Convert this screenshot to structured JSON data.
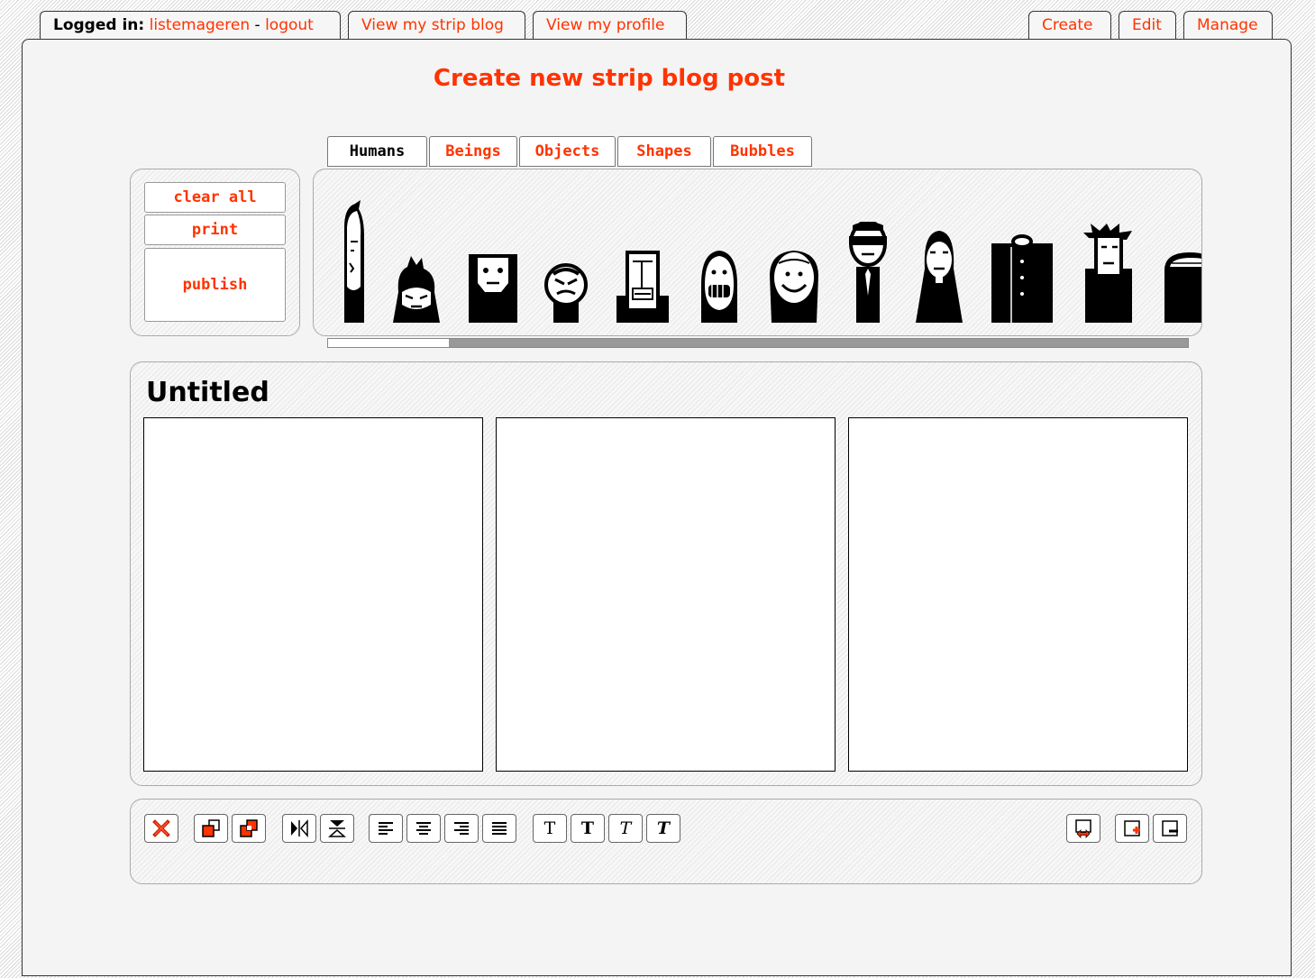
{
  "nav": {
    "logged_in_label": "Logged in:",
    "username": "listemageren",
    "separator": "-",
    "logout": "logout",
    "view_blog": "View my strip blog",
    "view_profile": "View my profile",
    "create": "Create",
    "edit": "Edit",
    "manage": "Manage"
  },
  "page_title": "Create new strip blog post",
  "categories": [
    "Humans",
    "Beings",
    "Objects",
    "Shapes",
    "Bubbles"
  ],
  "active_category": "Humans",
  "actions": {
    "clear_all": "clear all",
    "print": "print",
    "publish": "publish"
  },
  "palette_scroll_fraction": 0.14,
  "strip": {
    "title": "Untitled",
    "panel_count": 3
  },
  "toolbar": {
    "text_styles": [
      "T",
      "T",
      "T",
      "T"
    ]
  },
  "colors": {
    "accent": "#ff3300",
    "panel_background": "#f4f4f4"
  }
}
